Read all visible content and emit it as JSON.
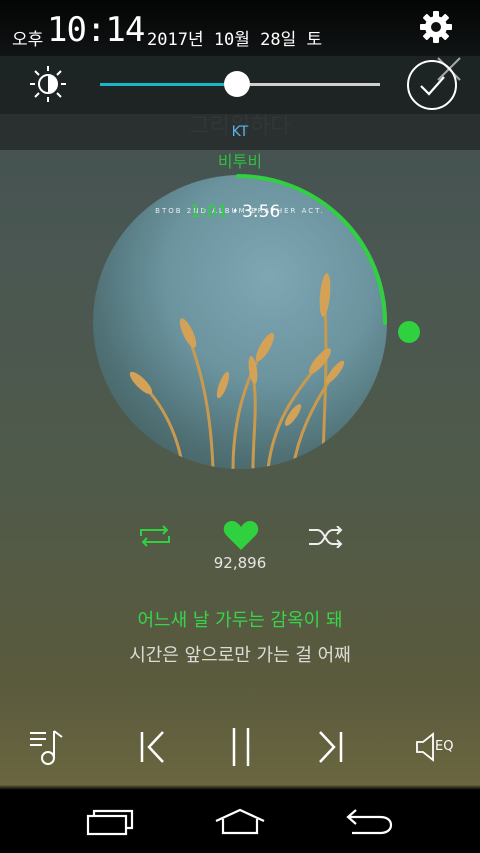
{
  "status": {
    "ampm": "오후",
    "time": "10:14",
    "date": "2017년 10월 28일 토"
  },
  "brightness": {
    "level_percent": 49
  },
  "now_playing": {
    "title": "그리워하다",
    "artist": "비투비",
    "album_text": "BTOB 2ND ALBUM  BRATHER ACT.",
    "elapsed": "1:01",
    "duration": "3:56",
    "progress_fraction": 0.26
  },
  "carrier": "KT",
  "likes": "92,896",
  "lyrics": {
    "current": "어느새 날 가두는 감옥이 돼",
    "next": "시간은 앞으로만 가는 걸 어째"
  },
  "eq_label": "EQ",
  "colors": {
    "accent": "#2fd13f",
    "slider_fill": "#16b7c7",
    "carrier": "#5ab4e8"
  },
  "icons": [
    "gear-icon",
    "brightness-icon",
    "auto-brightness-icon",
    "close-icon",
    "repeat-icon",
    "heart-icon",
    "shuffle-icon",
    "playlist-icon",
    "previous-icon",
    "pause-icon",
    "next-icon",
    "equalizer-icon",
    "recent-apps-icon",
    "home-icon",
    "back-icon"
  ]
}
